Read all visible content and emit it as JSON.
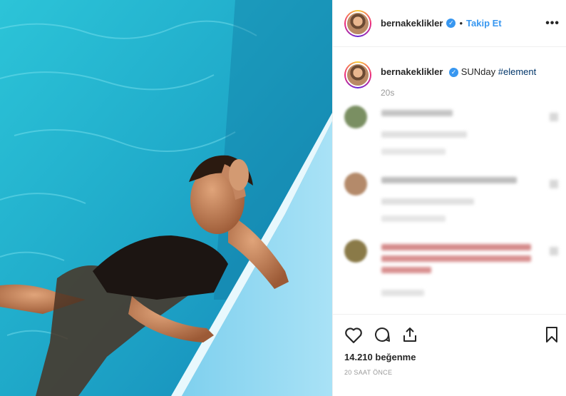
{
  "post": {
    "username": "bernakeklikler",
    "follow_label": "Takip Et",
    "separator": "•",
    "more_label": "•••",
    "caption_text": "SUNday",
    "caption_hashtag": "#element",
    "caption_time": "20s",
    "likes": "14.210 beğenme",
    "posted_ago": "20 SAAT ÖNCE"
  },
  "icons": {
    "verified": "verified-badge-icon",
    "more": "more-options-icon",
    "like": "heart-icon",
    "comment": "comment-icon",
    "share": "share-icon",
    "save": "bookmark-icon"
  },
  "colors": {
    "accent_blue": "#3897f0",
    "pool": "#2fb8cf",
    "text": "#262626",
    "muted": "#999999"
  }
}
